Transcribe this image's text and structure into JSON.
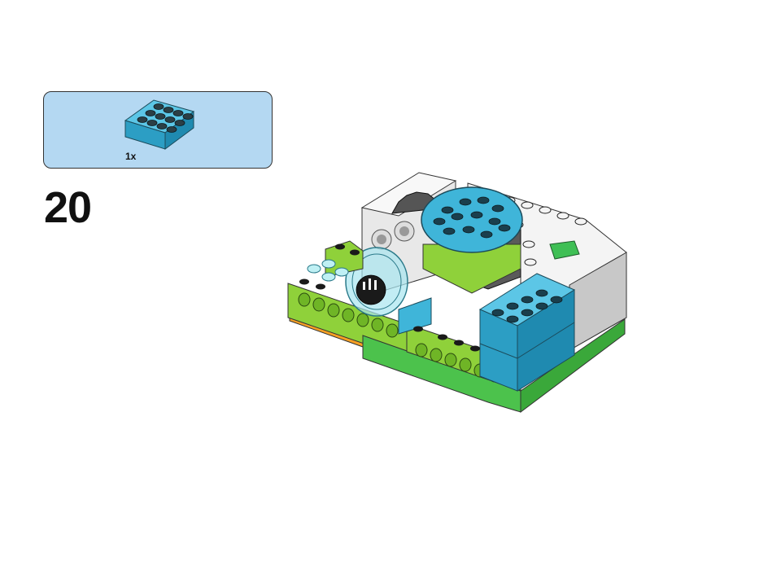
{
  "parts_list": {
    "items": [
      {
        "part": "brick-2x4",
        "color": "#3fb5d9",
        "quantity": "1x"
      }
    ]
  },
  "step": {
    "number": "20"
  },
  "colors": {
    "azure": "#3fb5d9",
    "lime": "#8fd13a",
    "green": "#4cc24c",
    "orange": "#f7a023",
    "white": "#f4f4f4",
    "gray": "#5a5a5a",
    "dark": "#1a1a1a"
  }
}
